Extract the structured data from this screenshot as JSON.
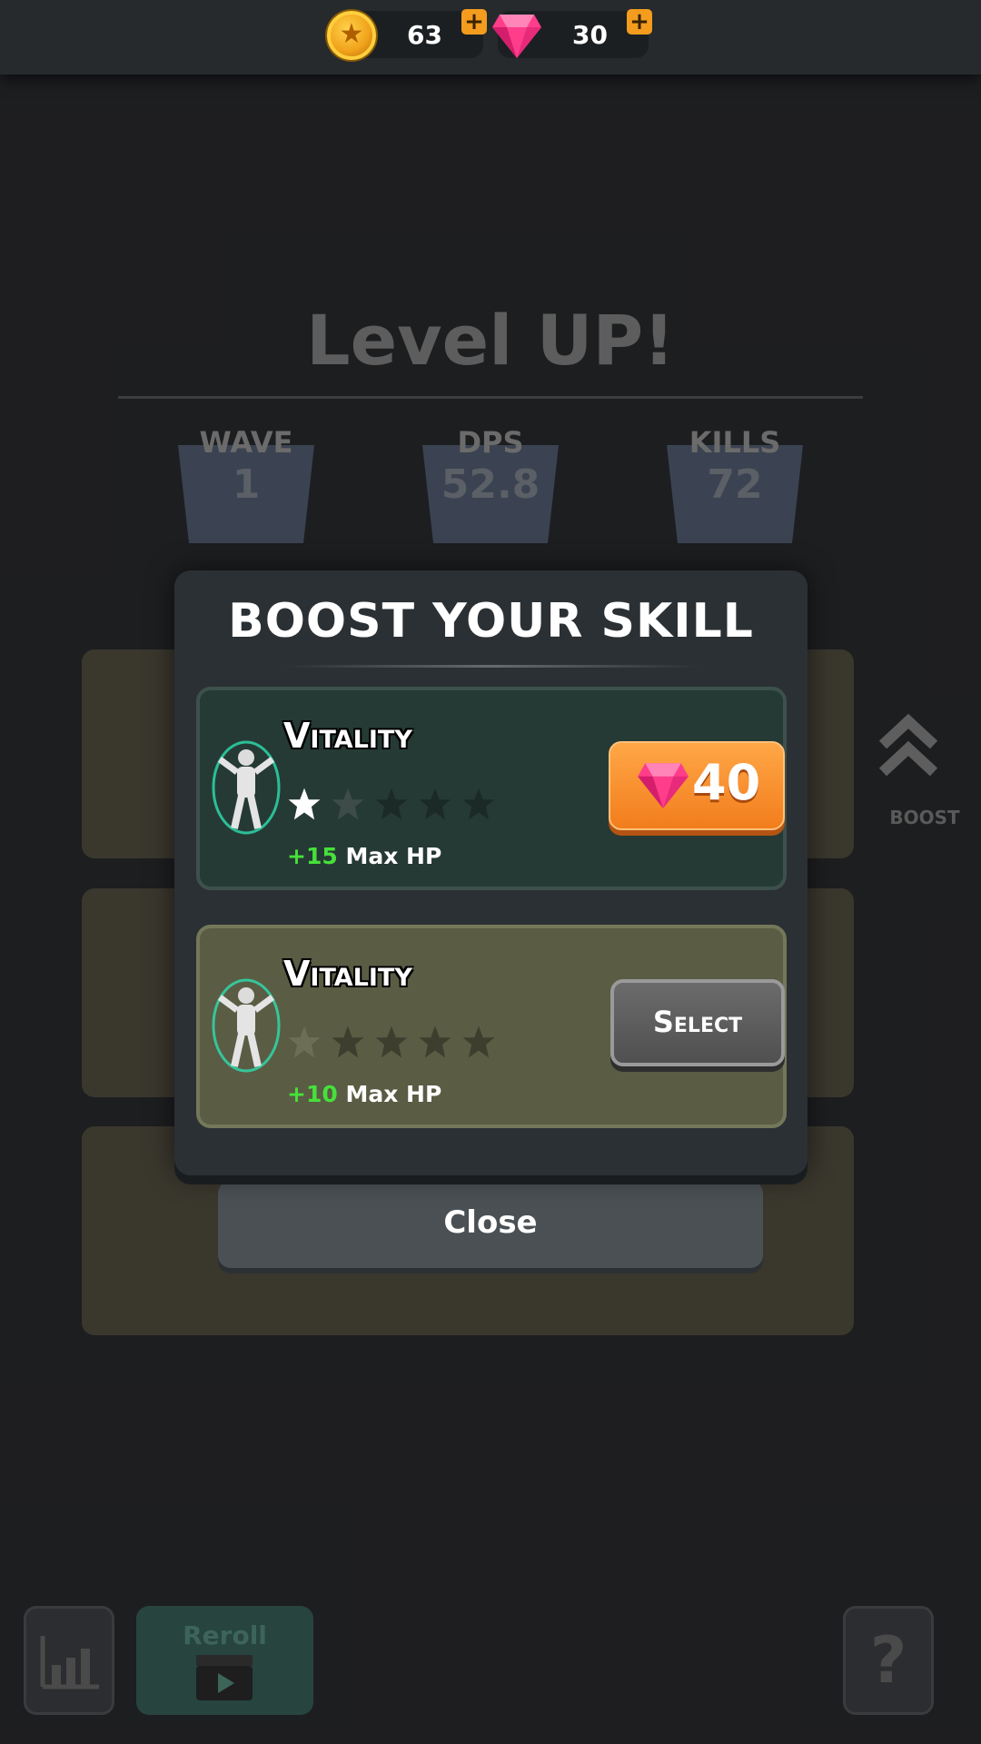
{
  "currency": {
    "coins": "63",
    "gems": "30"
  },
  "background": {
    "title": "Level UP!",
    "stats": [
      {
        "label": "WAVE",
        "value": "1"
      },
      {
        "label": "DPS",
        "value": "52.8"
      },
      {
        "label": "KILLS",
        "value": "72"
      }
    ],
    "boost_label": "BOOST",
    "reroll_label": "Reroll"
  },
  "modal": {
    "title": "BOOST YOUR SKILL",
    "options": [
      {
        "name": "Vitality",
        "stars_filled": 1,
        "stars_total": 5,
        "bonus": "+15",
        "stat": "Max HP",
        "price": "40",
        "icon": "vitality-hero-icon"
      },
      {
        "name": "Vitality",
        "stars_filled": 0,
        "stars_total": 5,
        "bonus": "+10",
        "stat": "Max HP",
        "button": "Select",
        "icon": "vitality-hero-icon"
      }
    ]
  },
  "close_label": "Close",
  "colors": {
    "accent_orange": "#f39c1e",
    "bonus_green": "#46e13a",
    "gem_pink": "#ff3d8b"
  }
}
